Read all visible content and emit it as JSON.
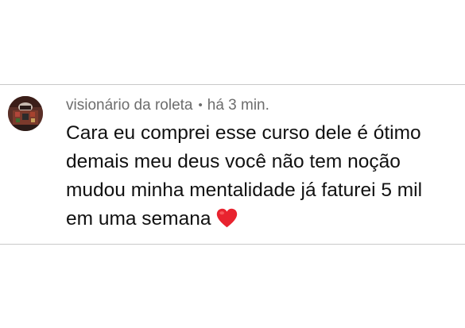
{
  "comment": {
    "username": "visionário da roleta",
    "separator": "•",
    "timestamp": "há 3 min.",
    "text_lines": [
      "Cara eu comprei esse curso dele é ótimo",
      "demais meu deus você não tem noção",
      "mudou minha mentalidade já faturei 5 mil",
      "em uma semana"
    ],
    "emoji": "red-heart-icon",
    "colors": {
      "username": "#6d6d6d",
      "text": "#111111",
      "heart": "#e8232f",
      "divider": "#c9c9c9"
    }
  }
}
